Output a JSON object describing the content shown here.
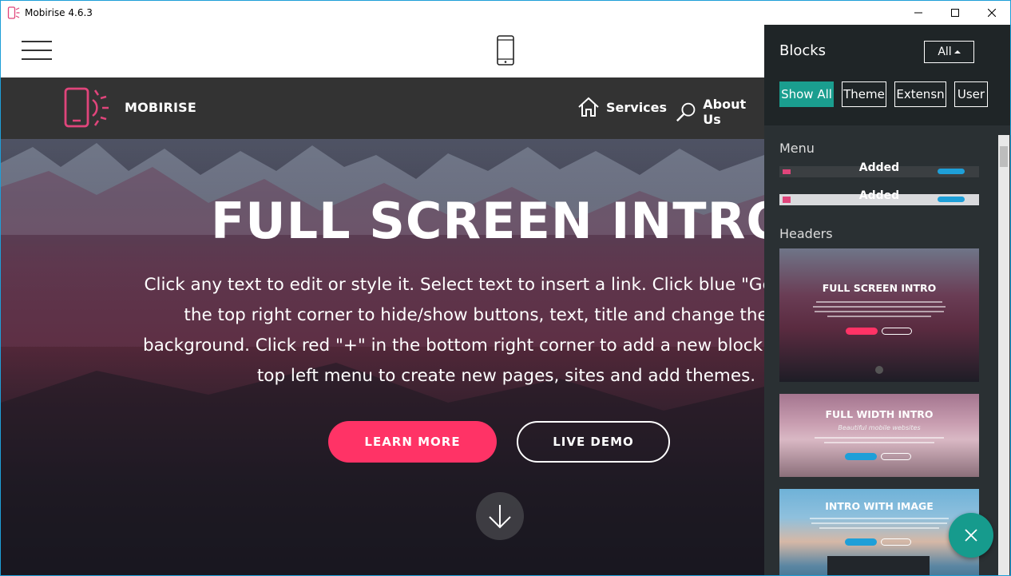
{
  "window": {
    "title": "Mobirise 4.6.3",
    "accent": "#1e9fd8"
  },
  "editor": {
    "menu_icon": "hamburger-icon",
    "device_icon": "mobile-phone-icon"
  },
  "site": {
    "brand": "MOBIRISE",
    "nav": [
      {
        "label": "Services",
        "icon": "home-icon"
      },
      {
        "label": "About Us",
        "icon": "search-icon"
      }
    ],
    "hero": {
      "title": "FULL SCREEN INTRO",
      "text_lines": [
        "Click any text to edit or style it. Select text to insert a link. Click blue \"Gear\" icon in",
        "the top right corner to hide/show buttons, text, title and change the block",
        "background. Click red \"+\" in the bottom right corner to add a new block. Use the",
        "top left menu to create new pages, sites and add themes."
      ],
      "primary_button": "LEARN MORE",
      "secondary_button": "LIVE DEMO",
      "primary_color": "#ff3366"
    }
  },
  "panel": {
    "title": "Blocks",
    "filter_value": "All",
    "tabs": [
      "Show All",
      "Theme",
      "Extensn",
      "User"
    ],
    "active_tab_color": "#1a9e8f",
    "sections": [
      {
        "label": "Menu",
        "items": [
          "Added",
          "Added"
        ]
      },
      {
        "label": "Headers",
        "items": [
          {
            "title": "FULL SCREEN INTRO",
            "subtitle": ""
          },
          {
            "title": "FULL WIDTH INTRO",
            "subtitle": "Beautiful mobile websites"
          },
          {
            "title": "INTRO WITH IMAGE",
            "subtitle": ""
          }
        ]
      }
    ]
  },
  "fab": {
    "icon": "close-icon",
    "color": "#169b8d"
  }
}
